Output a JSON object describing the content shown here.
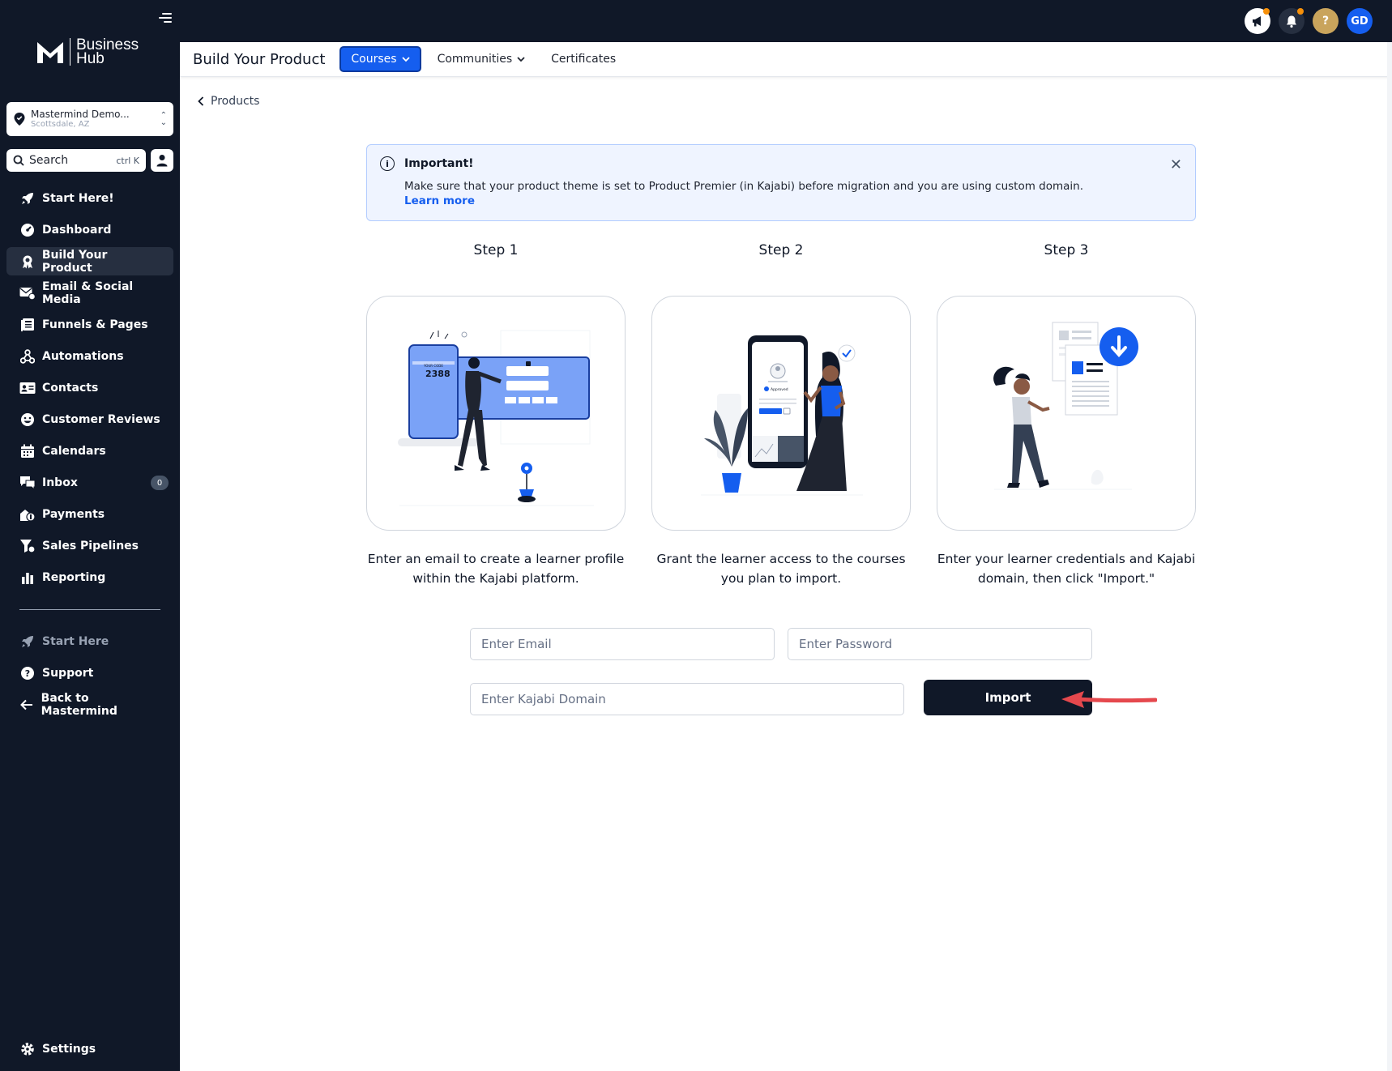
{
  "brand": {
    "line1": "Business",
    "line2": "Hub"
  },
  "account": {
    "name": "Mastermind Demo...",
    "location": "Scottsdale, AZ"
  },
  "search": {
    "label": "Search",
    "shortcut": "ctrl K"
  },
  "sidebar": {
    "items": [
      {
        "label": "Start Here!",
        "icon": "rocket-icon"
      },
      {
        "label": "Dashboard",
        "icon": "gauge-icon"
      },
      {
        "label": "Build Your Product",
        "icon": "award-icon",
        "active": true
      },
      {
        "label": "Email & Social Media",
        "icon": "mail-icon"
      },
      {
        "label": "Funnels & Pages",
        "icon": "pages-icon"
      },
      {
        "label": "Automations",
        "icon": "workflow-icon"
      },
      {
        "label": "Contacts",
        "icon": "contact-card-icon"
      },
      {
        "label": "Customer Reviews",
        "icon": "smile-icon"
      },
      {
        "label": "Calendars",
        "icon": "calendar-icon"
      },
      {
        "label": "Inbox",
        "icon": "chat-icon",
        "badge": "0"
      },
      {
        "label": "Payments",
        "icon": "payments-icon"
      },
      {
        "label": "Sales Pipelines",
        "icon": "funnel-icon"
      },
      {
        "label": "Reporting",
        "icon": "bar-chart-icon"
      }
    ],
    "bottom": [
      {
        "label": "Start Here",
        "icon": "rocket-icon",
        "muted": true
      },
      {
        "label": "Support",
        "icon": "help-icon"
      },
      {
        "label": "Back to Mastermind",
        "icon": "arrow-left-icon"
      }
    ],
    "settings": "Settings"
  },
  "topbar": {
    "avatar_initials": "GD",
    "help": "?"
  },
  "subnav": {
    "title": "Build Your Product",
    "tabs": [
      {
        "label": "Courses",
        "active": true
      },
      {
        "label": "Communities"
      },
      {
        "label": "Certificates"
      }
    ]
  },
  "breadcrumb": "Products",
  "alert": {
    "title": "Important!",
    "body": "Make sure that your product theme is set to Product Premier (in Kajabi) before migration and you are using custom domain.",
    "link": "Learn more"
  },
  "steps": [
    {
      "title": "Step 1",
      "text": "Enter an email to create a learner profile within the Kajabi platform.",
      "code": "2388",
      "code_label": "YOUR CODE"
    },
    {
      "title": "Step 2",
      "text": "Grant the learner access to the courses you plan to import.",
      "approved": "Approved"
    },
    {
      "title": "Step 3",
      "text": "Enter your learner credentials and Kajabi domain, then click \"Import.\""
    }
  ],
  "form": {
    "email_placeholder": "Enter Email",
    "password_placeholder": "Enter Password",
    "domain_placeholder": "Enter Kajabi Domain",
    "import_label": "Import"
  },
  "colors": {
    "accent": "#155eef",
    "dark": "#101828",
    "arrow": "#e5484d",
    "dot": "#f79009",
    "help": "#c9a45c"
  }
}
